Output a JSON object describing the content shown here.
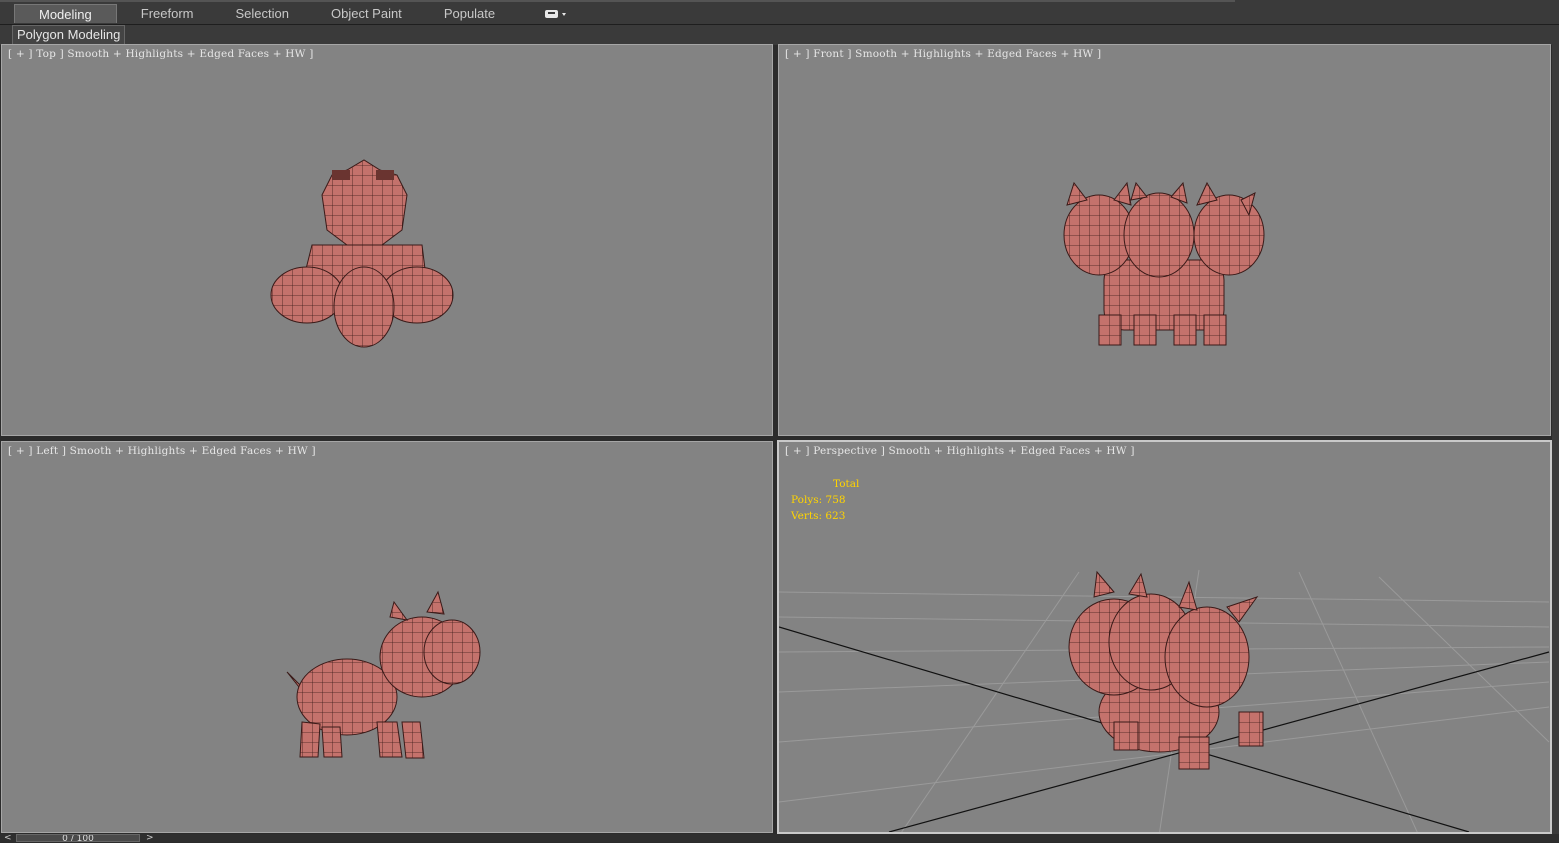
{
  "tabs": [
    {
      "label": "Modeling",
      "active": true
    },
    {
      "label": "Freeform"
    },
    {
      "label": "Selection"
    },
    {
      "label": "Object Paint"
    },
    {
      "label": "Populate"
    }
  ],
  "ribbon": {
    "label": "Polygon Modeling"
  },
  "viewports": {
    "top": {
      "label": "[ + ] Top ] Smooth + Highlights + Edged Faces + HW ]"
    },
    "front": {
      "label": "[ + ] Front ] Smooth + Highlights + Edged Faces + HW ]"
    },
    "left": {
      "label": "[ + ] Left ] Smooth + Highlights + Edged Faces + HW ]"
    },
    "perspective": {
      "label": "[ + ] Perspective ] Smooth + Highlights + Edged Faces + HW ]",
      "stats": {
        "total_label": "Total",
        "polys": "Polys: 758",
        "verts": "Verts: 623"
      }
    }
  },
  "timeline": {
    "frame": "0 / 100",
    "prev": "<",
    "next": ">"
  },
  "colors": {
    "viewport_bg": "#838383",
    "model": "#c0706b",
    "stats_text": "#ffd400"
  }
}
